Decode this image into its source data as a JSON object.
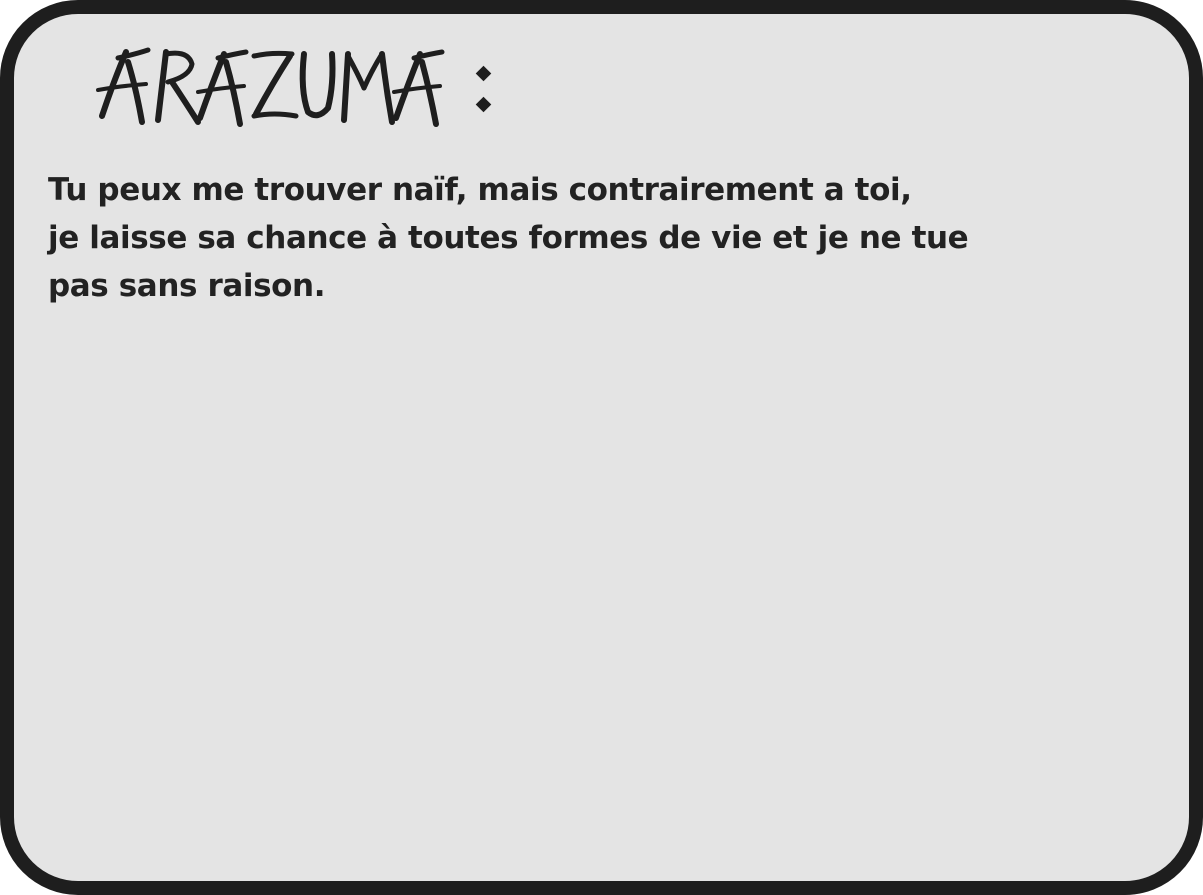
{
  "dialog": {
    "speaker": "ARAZUMA",
    "speaker_suffix": ":",
    "lines": [
      "Tu peux me trouver naïf, mais contrairement a toi,",
      "je laisse sa chance à toutes formes de vie et je ne tue",
      "pas sans raison."
    ]
  },
  "colors": {
    "box_fill": "#e4e4e4",
    "box_border": "#1e1e1e",
    "text": "#222222"
  }
}
